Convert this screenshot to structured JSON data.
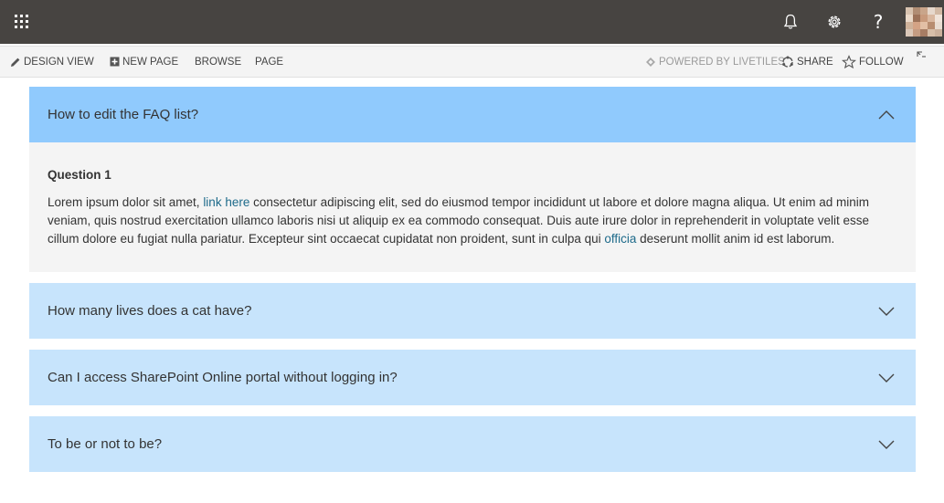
{
  "ribbon": {
    "design_view": "DESIGN VIEW",
    "new_page": "NEW PAGE",
    "browse": "BROWSE",
    "page": "PAGE",
    "powered_by": "POWERED BY LIVETILES",
    "share": "SHARE",
    "follow": "FOLLOW"
  },
  "suitebar": {
    "help_glyph": "?"
  },
  "faq": {
    "items": [
      {
        "title": "How to edit the FAQ list?",
        "expanded": true,
        "question_title": "Question 1",
        "text_1": "Lorem ipsum dolor sit amet, ",
        "link_1": "link here",
        "text_2": " consectetur adipiscing elit, sed do eiusmod tempor incididunt ut labore et dolore magna aliqua. Ut enim ad minim veniam, quis nostrud exercitation ullamco laboris nisi ut aliquip ex ea commodo consequat. Duis aute irure dolor in reprehenderit in voluptate velit esse cillum dolore eu fugiat nulla pariatur. Excepteur sint occaecat cupidatat non proident, sunt in culpa qui ",
        "link_2": "officia",
        "text_3": " deserunt mollit anim id est laborum."
      },
      {
        "title": "How many lives does a cat have?",
        "expanded": false
      },
      {
        "title": "Can I access SharePoint Online portal without logging in?",
        "expanded": false
      },
      {
        "title": "To be or not to be?",
        "expanded": false
      }
    ]
  },
  "colors": {
    "suitebar": "#474441",
    "accordion_open": "#90cafd",
    "accordion_closed": "#c7e4fc",
    "panel": "#f4f4f4",
    "link": "#1d6a8a"
  }
}
